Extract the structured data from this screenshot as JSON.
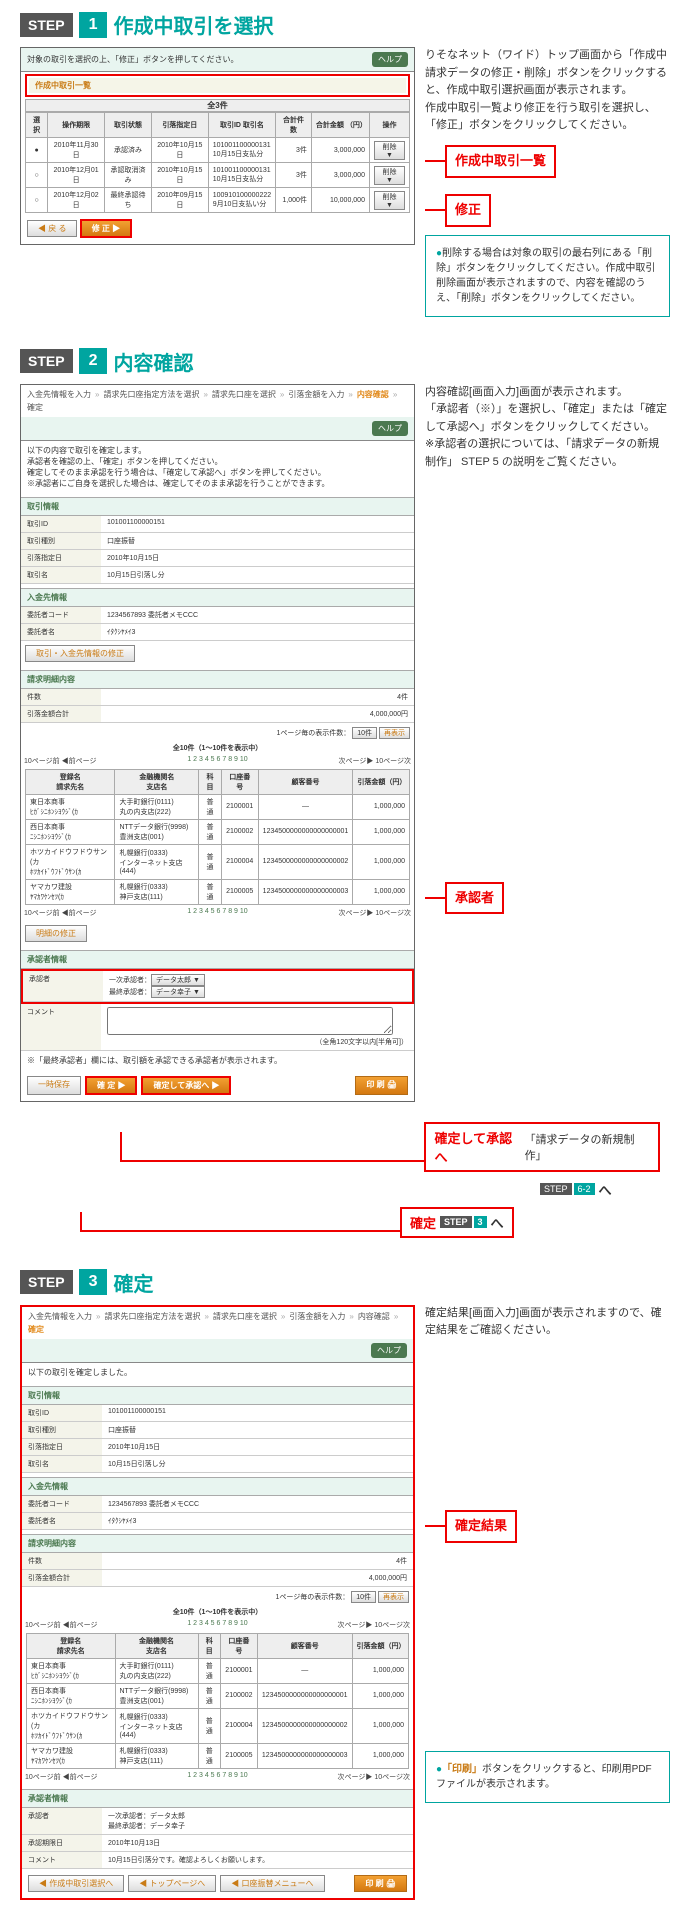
{
  "step1": {
    "label": "STEP",
    "num": "1",
    "title": "作成中取引を選択",
    "side_text": "りそなネット（ワイド）トップ画面から「作成中請求データの修正・削除」ボタンをクリックすると、作成中取引選択画面が表示されます。\n作成中取引一覧より修正を行う取引を選択し、「修正」ボタンをクリックしてください。",
    "callout_list": "作成中取引一覧",
    "callout_fix": "修正",
    "tip": "削除する場合は対象の取引の最右列にある「削除」ボタンをクリックしてください。作成中取引削除画面が表示されますので、内容を確認のうえ、「削除」ボタンをクリックしてください。",
    "panel": {
      "instr": "対象の取引を選択の上、「修正」ボタンを押してください。",
      "help": "ヘルプ",
      "list_title": "作成中取引一覧",
      "count_label": "全3件",
      "headers": [
        "選択",
        "操作期限",
        "取引状態",
        "引落指定日",
        "取引ID\n取引名",
        "合計件数",
        "合計金額\n（円）",
        "操作"
      ],
      "rows": [
        {
          "sel": "●",
          "d": "2010年11月30日",
          "st": "承認済み",
          "dd": "2010年10月15日",
          "id": "101001100000131\n10月15日支払分",
          "n": "3件",
          "amt": "3,000,000",
          "op": "削除 ▼"
        },
        {
          "sel": "○",
          "d": "2010年12月01日",
          "st": "承認取消済み",
          "dd": "2010年10月15日",
          "id": "101001100000131\n10月15日支払分",
          "n": "3件",
          "amt": "3,000,000",
          "op": "削除 ▼"
        },
        {
          "sel": "○",
          "d": "2010年12月02日",
          "st": "最終承認待ち",
          "dd": "2010年09月15日",
          "id": "100910100000222\n9月10日支払い分",
          "n": "1,000件",
          "amt": "10,000,000",
          "op": "削除 ▼"
        }
      ],
      "back_btn": "◀ 戻 る",
      "fix_btn": "修 正 ▶"
    }
  },
  "step2": {
    "label": "STEP",
    "num": "2",
    "title": "内容確認",
    "side_text": "内容確認[画面入力]画面が表示されます。\n「承認者（※）」を選択し、「確定」または「確定して承認へ」ボタンをクリックしてください。\n※承認者の選択については、「請求データの新規制作」 STEP 5 の説明をご覧ください。",
    "callout_approver": "承認者",
    "callout_confirm_go": "確定して承認へ",
    "callout_confirm_go_sub": "「請求データの新規制作」",
    "callout_confirm_go_step_lbl": "STEP",
    "callout_confirm_go_step_num": "6-2",
    "callout_confirm_go_suf": "へ",
    "callout_confirm": "確定",
    "callout_confirm_step_lbl": "STEP",
    "callout_confirm_step_num": "3",
    "callout_confirm_suf": "へ",
    "panel": {
      "breadcrumbs": [
        "入金先情報を入力",
        "請求先口座指定方法を選択",
        "請求先口座を選択",
        "引落金額を入力",
        "内容確認",
        "確定"
      ],
      "active_bc": 4,
      "help": "ヘルプ",
      "instr1": "以下の内容で取引を確定します。",
      "instr2": "承認者を確認の上、「確定」ボタンを押してください。",
      "instr3": "確定してそのまま承認を行う場合は、「確定して承認へ」ボタンを押してください。",
      "instr4": "※承認者にご自身を選択した場合は、確定してそのまま承認を行うことができます。",
      "sec_trx": "取引情報",
      "f_trx_id_l": "取引ID",
      "f_trx_id_v": "101001100000151",
      "f_kind_l": "取引種別",
      "f_kind_v": "口座振替",
      "f_date_l": "引落指定日",
      "f_date_v": "2010年10月15日",
      "f_name_l": "取引名",
      "f_name_v": "10月15日引落し分",
      "sec_payer": "入金先情報",
      "f_code_l": "委託者コード",
      "f_code_v": "1234567893 委託者メモCCC",
      "f_cname_l": "委託者名",
      "f_cname_v": "ｲﾀｸｼﾔﾒｲ3",
      "link_edit_payer": "取引・入金先情報の修正",
      "sec_detail": "請求明細内容",
      "f_cnt_l": "件数",
      "f_cnt_v": "4件",
      "f_amt_l": "引落金額合計",
      "f_amt_v": "4,000,000円",
      "per_page": "1ページ毎の表示件数：",
      "per_page_val": "10件",
      "redisplay": "再表示",
      "pager_title": "全10件（1～10件を表示中）",
      "pager_prev": "10ページ前 ◀前ページ",
      "pager_nums": "1  2  3  4  5  6  7  8  9  10",
      "pager_next": "次ページ▶  10ページ次",
      "tbl_headers": [
        "登録名\n請求先名",
        "金融機関名\n支店名",
        "科目",
        "口座番号",
        "顧客番号",
        "引落金額（円）"
      ],
      "tbl_rows": [
        {
          "a": "東日本商事\nﾋｶﾞｼﾆﾎﾝｼﾖｳｼﾞ(ｶ",
          "b": "大手町銀行(0111)\n丸の内支店(222)",
          "c": "普通",
          "d": "2100001",
          "e": "—",
          "f": "1,000,000"
        },
        {
          "a": "西日本商事\nﾆｼﾆﾎﾝｼﾖｳｼﾞ(ｶ",
          "b": "NTTデータ銀行(9998)\n豊洲支店(001)",
          "c": "普通",
          "d": "2100002",
          "e": "1234500000000000000001",
          "f": "1,000,000"
        },
        {
          "a": "ホツカイドウフドウサン(カ\nﾎﾂｶｲﾄﾞｳﾌﾄﾞｳｻﾝ(ｶ",
          "b": "札幌銀行(0333)\nインターネット支店(444)",
          "c": "普通",
          "d": "2100004",
          "e": "1234500000000000000002",
          "f": "1,000,000"
        },
        {
          "a": "ヤマカワ建設\nﾔﾏｶﾜｹﾝｾﾂ(ｶ",
          "b": "札幌銀行(0333)\n神戸支店(111)",
          "c": "普通",
          "d": "2100005",
          "e": "1234500000000000000003",
          "f": "1,000,000"
        }
      ],
      "link_edit_detail": "明細の修正",
      "sec_approver": "承認者情報",
      "f_appr_l": "承認者",
      "appr1_l": "一次承認者：",
      "appr1_v": "データ太郎 ▼",
      "appr2_l": "最終承認者：",
      "appr2_v": "データ幸子 ▼",
      "f_comment_l": "コメント",
      "f_comment_note": "（全角120文字以内[半角可]）",
      "appr_note": "※「最終承認者」欄には、取引額を承認できる承認者が表示されます。",
      "btn_save": "一時保存",
      "btn_confirm": "確 定 ▶",
      "btn_confirm_go": "確定して承認へ ▶",
      "btn_print": "印 刷 🖨"
    }
  },
  "step3": {
    "label": "STEP",
    "num": "3",
    "title": "確定",
    "side_text": "確定結果[画面入力]画面が表示されますので、確定結果をご確認ください。",
    "callout_result": "確定結果",
    "tip": "「印刷」ボタンをクリックすると、印刷用PDFファイルが表示されます。",
    "panel": {
      "breadcrumbs": [
        "入金先情報を入力",
        "請求先口座指定方法を選択",
        "請求先口座を選択",
        "引落金額を入力",
        "内容確認",
        "確定"
      ],
      "active_bc": 5,
      "help": "ヘルプ",
      "instr": "以下の取引を確定しました。",
      "sec_trx": "取引情報",
      "f_trx_id_l": "取引ID",
      "f_trx_id_v": "101001100000151",
      "f_kind_l": "取引種別",
      "f_kind_v": "口座振替",
      "f_date_l": "引落指定日",
      "f_date_v": "2010年10月15日",
      "f_name_l": "取引名",
      "f_name_v": "10月15日引落し分",
      "sec_payer": "入金先情報",
      "f_code_l": "委託者コード",
      "f_code_v": "1234567893 委託者メモCCC",
      "f_cname_l": "委託者名",
      "f_cname_v": "ｲﾀｸｼﾔﾒｲ3",
      "sec_detail": "請求明細内容",
      "f_cnt_l": "件数",
      "f_cnt_v": "4件",
      "f_amt_l": "引落金額合計",
      "f_amt_v": "4,000,000円",
      "per_page": "1ページ毎の表示件数：",
      "per_page_val": "10件",
      "redisplay": "再表示",
      "pager_title": "全10件（1～10件を表示中）",
      "pager_prev": "10ページ前  ◀前ページ",
      "pager_nums": "1  2  3  4  5  6  7  8  9  10",
      "pager_next": "次ページ▶  10ページ次",
      "tbl_headers": [
        "登録名\n請求先名",
        "金融機関名\n支店名",
        "科目",
        "口座番号",
        "顧客番号",
        "引落金額（円）"
      ],
      "tbl_rows": [
        {
          "a": "東日本商事\nﾋｶﾞｼﾆﾎﾝｼﾖｳｼﾞ(ｶ",
          "b": "大手町銀行(0111)\n丸の内支店(222)",
          "c": "普通",
          "d": "2100001",
          "e": "—",
          "f": "1,000,000"
        },
        {
          "a": "西日本商事\nﾆｼﾆﾎﾝｼﾖｳｼﾞ(ｶ",
          "b": "NTTデータ銀行(9998)\n豊洲支店(001)",
          "c": "普通",
          "d": "2100002",
          "e": "1234500000000000000001",
          "f": "1,000,000"
        },
        {
          "a": "ホツカイドウフドウサン(カ\nﾎﾂｶｲﾄﾞｳﾌﾄﾞｳｻﾝ(ｶ",
          "b": "札幌銀行(0333)\nインターネット支店(444)",
          "c": "普通",
          "d": "2100004",
          "e": "1234500000000000000002",
          "f": "1,000,000"
        },
        {
          "a": "ヤマカワ建設\nﾔﾏｶﾜｹﾝｾﾂ(ｶ",
          "b": "札幌銀行(0333)\n神戸支店(111)",
          "c": "普通",
          "d": "2100005",
          "e": "1234500000000000000003",
          "f": "1,000,000"
        }
      ],
      "sec_approver": "承認者情報",
      "f_appr_l": "承認者",
      "f_appr_v": "一次承認者：データ太郎\n最終承認者：データ幸子",
      "f_deadline_l": "承認期限日",
      "f_deadline_v": "2010年10月13日",
      "f_comment_l": "コメント",
      "f_comment_v": "10月15日引落分です。確認よろしくお願いします。",
      "btn_back": "◀ 作成中取引選択へ",
      "btn_top": "◀ トップページへ",
      "btn_menu": "◀ 口座振替メニューへ",
      "btn_print": "印 刷 🖨"
    }
  }
}
